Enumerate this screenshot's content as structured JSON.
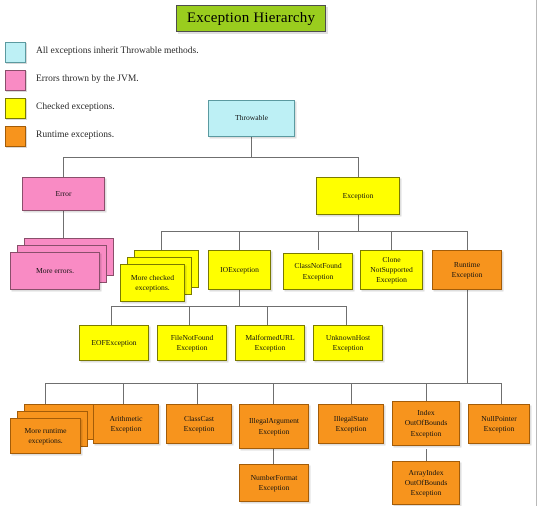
{
  "title": "Exception Hierarchy",
  "legend": {
    "items": [
      {
        "color": "#bdf0f5",
        "swatch_name": "legend-swatch-throwable",
        "text": "All exceptions inherit Throwable methods."
      },
      {
        "color": "#f98bc4",
        "swatch_name": "legend-swatch-error",
        "text": "Errors thrown by the JVM."
      },
      {
        "color": "#ffff00",
        "swatch_name": "legend-swatch-checked",
        "text": "Checked exceptions."
      },
      {
        "color": "#f7941d",
        "swatch_name": "legend-swatch-runtime",
        "text": "Runtime exceptions."
      }
    ]
  },
  "colors": {
    "title_bg": "#9acd1e",
    "throwable": "#bdf0f5",
    "error": "#f98bc4",
    "checked": "#ffff00",
    "runtime": "#f7941d",
    "connector": "#6f6f6f",
    "background": "#ffffff"
  },
  "nodes": {
    "throwable": "Throwable",
    "error": "Error",
    "more_errors": "More errors.",
    "exception": "Exception",
    "more_checked": "More checked\nexceptions.",
    "ioexception": "IOException",
    "class_not_found": "ClassNotFound\nException",
    "clone_not_supported": "Clone\nNotSupported\nException",
    "runtime_exception": "Runtime\nException",
    "eof_exception": "EOFException",
    "file_not_found": "FileNotFound\nException",
    "malformed_url": "MalformedURL\nException",
    "unknown_host": "UnknownHost\nException",
    "more_runtime": "More runtime\nexceptions.",
    "arithmetic": "Arithmetic\nException",
    "class_cast": "ClassCast\nException",
    "illegal_argument": "IllegalArgument\nException",
    "illegal_state": "IllegalState\nException",
    "index_out_of_bounds": "Index\nOutOfBounds\nException",
    "null_pointer": "NullPointer\nException",
    "number_format": "NumberFormat\nException",
    "array_index_out_of_bounds": "ArrayIndex\nOutOfBounds\nException"
  }
}
